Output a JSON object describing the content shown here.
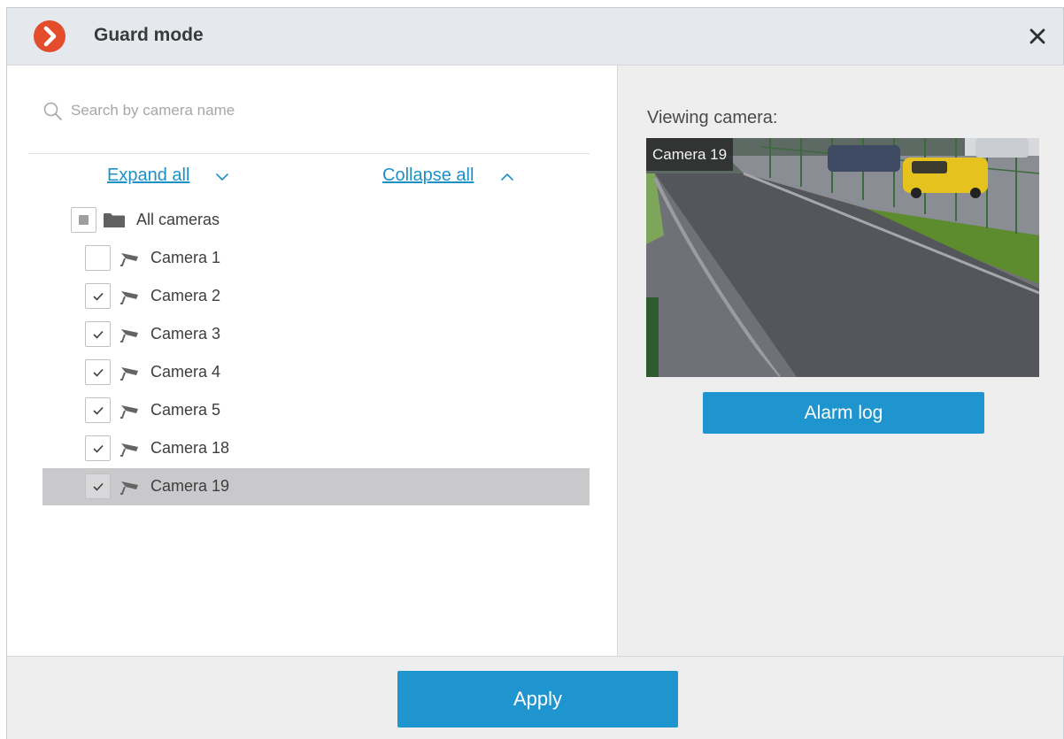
{
  "window": {
    "title": "Guard mode",
    "logo_icon": "app-logo-icon",
    "close_icon": "close-icon"
  },
  "search": {
    "placeholder": "Search by camera name",
    "value": ""
  },
  "tree_controls": {
    "expand_label": "Expand all",
    "collapse_label": "Collapse all"
  },
  "tree": {
    "root": {
      "label": "All cameras",
      "state": "partial"
    },
    "items": [
      {
        "label": "Camera 1",
        "checked": false,
        "selected": false
      },
      {
        "label": "Camera 2",
        "checked": true,
        "selected": false
      },
      {
        "label": "Camera 3",
        "checked": true,
        "selected": false
      },
      {
        "label": "Camera 4",
        "checked": true,
        "selected": false
      },
      {
        "label": "Camera 5",
        "checked": true,
        "selected": false
      },
      {
        "label": "Camera 18",
        "checked": true,
        "selected": false
      },
      {
        "label": "Camera 19",
        "checked": true,
        "selected": true
      }
    ]
  },
  "viewer": {
    "heading": "Viewing camera:",
    "camera_tag": "Camera 19",
    "alarm_log_label": "Alarm log"
  },
  "footer": {
    "apply_label": "Apply"
  },
  "colors": {
    "accent": "#1f95d0",
    "logo": "#e34d2c",
    "selected_row": "#c9c9cc"
  }
}
